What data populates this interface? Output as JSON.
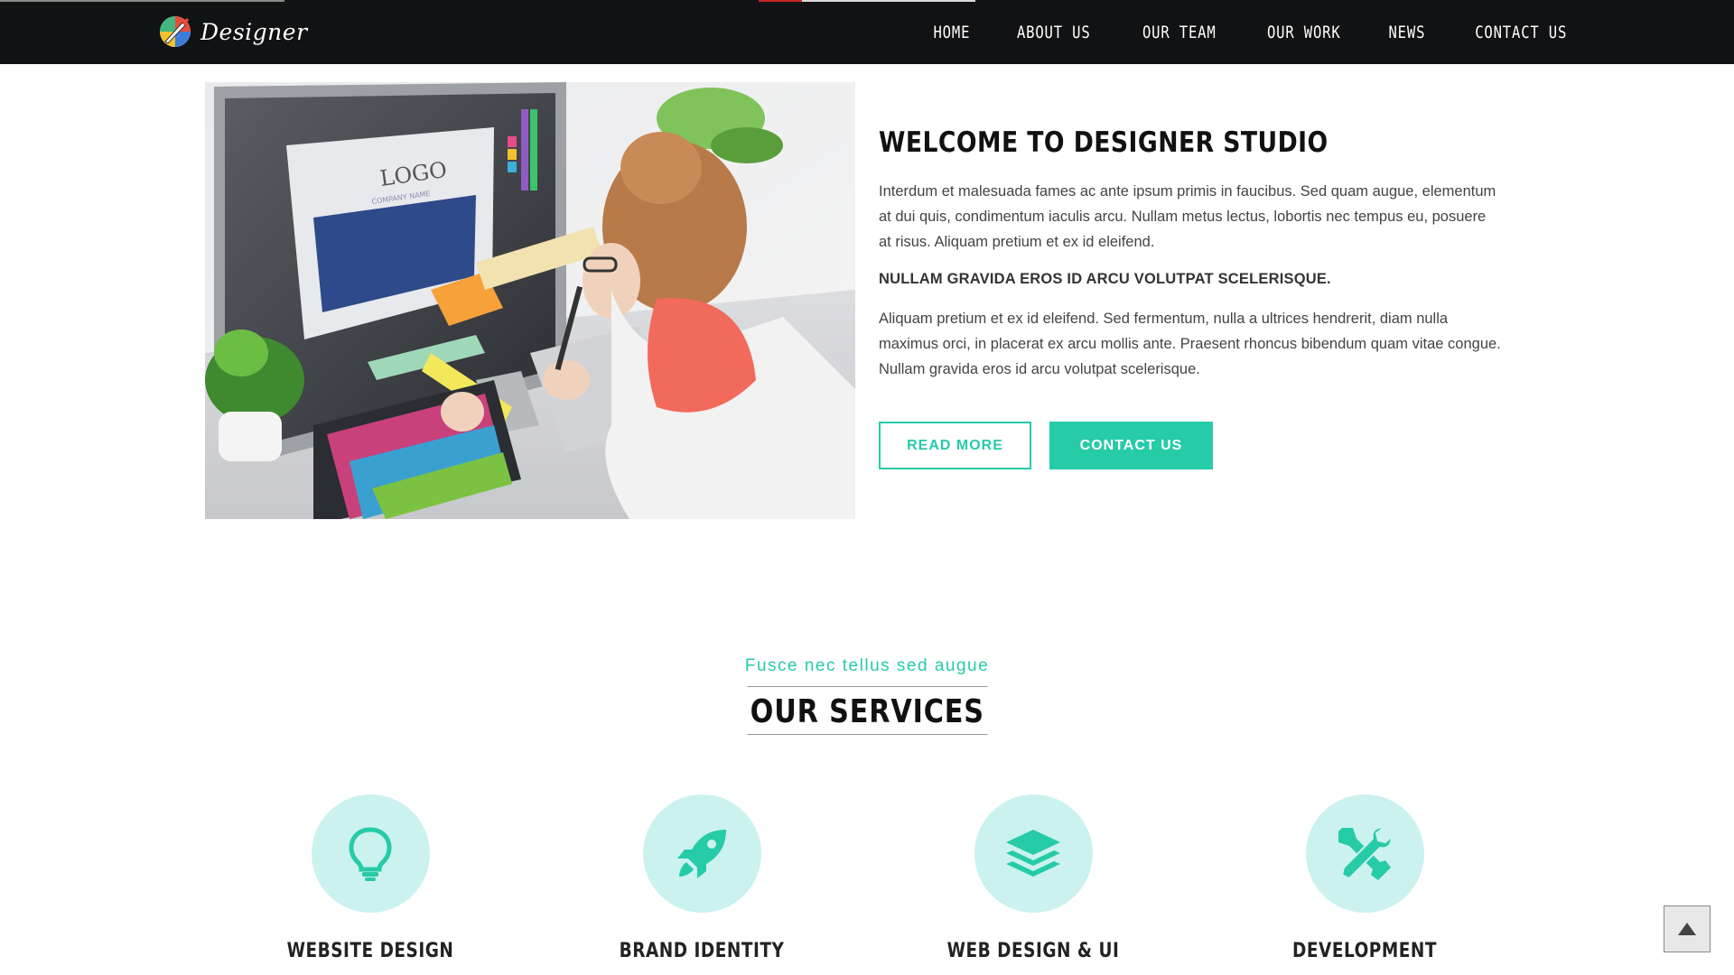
{
  "header": {
    "logo_text": "Designer",
    "nav": [
      "Home",
      "About Us",
      "Our Team",
      "Our Work",
      "News",
      "Contact Us"
    ]
  },
  "welcome": {
    "title": "WELCOME TO DESIGNER STUDIO",
    "paragraph1": "Interdum et malesuada fames ac ante ipsum primis in faucibus. Sed quam augue, elementum at dui quis, condimentum iaculis arcu. Nullam metus lectus, lobortis nec tempus eu, posuere at risus. Aliquam pretium et ex id eleifend.",
    "subheading": "NULLAM GRAVIDA EROS ID ARCU VOLUTPAT SCELERISQUE.",
    "paragraph2": "Aliquam pretium et ex id eleifend. Sed fermentum, nulla a ultrices hendrerit, diam nulla maximus orci, in placerat ex arcu mollis ante. Praesent rhoncus bibendum quam vitae congue. Nullam gravida eros id arcu volutpat scelerisque.",
    "read_more": "READ MORE",
    "contact_us": "CONTACT US",
    "image_label": "LOGO",
    "image_sub_label": "COMPANY NAME"
  },
  "services": {
    "tagline": "Fusce nec tellus sed augue",
    "title": "OUR SERVICES",
    "items": [
      {
        "title": "WEBSITE DESIGN",
        "icon": "lightbulb-icon"
      },
      {
        "title": "BRAND IDENTITY",
        "icon": "rocket-icon"
      },
      {
        "title": "WEB DESIGN & UI",
        "icon": "layers-icon"
      },
      {
        "title": "DEVELOPMENT",
        "icon": "tools-icon"
      }
    ]
  },
  "colors": {
    "accent": "#26cba8",
    "header_bg": "#111214",
    "icon_circle": "#ccf2ef"
  }
}
